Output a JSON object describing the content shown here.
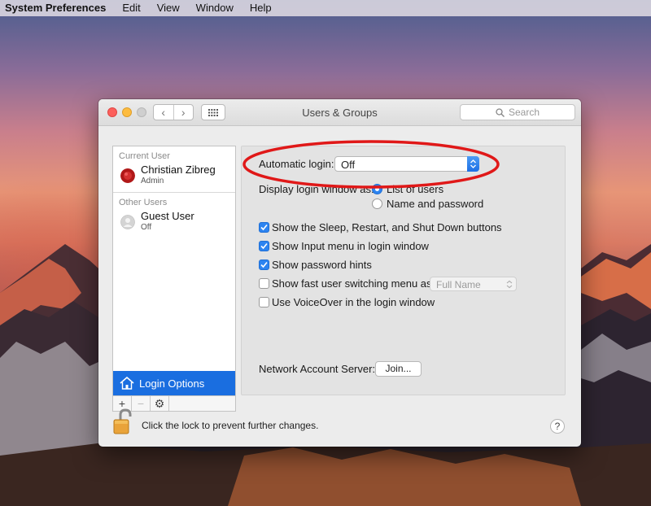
{
  "menubar": {
    "app": "System Preferences",
    "items": [
      "Edit",
      "View",
      "Window",
      "Help"
    ]
  },
  "window": {
    "title": "Users & Groups",
    "search_placeholder": "Search"
  },
  "sidebar": {
    "current_user_header": "Current User",
    "current_user": {
      "name": "Christian Zibreg",
      "role": "Admin"
    },
    "other_users_header": "Other Users",
    "other_users": [
      {
        "name": "Guest User",
        "role": "Off"
      }
    ],
    "login_options": "Login Options"
  },
  "panel": {
    "automatic_login_label": "Automatic login:",
    "automatic_login_value": "Off",
    "display_login_label": "Display login window as:",
    "display_options": [
      {
        "label": "List of users",
        "selected": true
      },
      {
        "label": "Name and password",
        "selected": false
      }
    ],
    "checkboxes": [
      {
        "label": "Show the Sleep, Restart, and Shut Down buttons",
        "checked": true
      },
      {
        "label": "Show Input menu in login window",
        "checked": true
      },
      {
        "label": "Show password hints",
        "checked": true
      },
      {
        "label": "Show fast user switching menu as",
        "checked": false
      },
      {
        "label": "Use VoiceOver in the login window",
        "checked": false
      }
    ],
    "fast_switch_value": "Full Name",
    "network_server_label": "Network Account Server:",
    "join_button": "Join..."
  },
  "footer": {
    "lock_text": "Click the lock to prevent further changes.",
    "help": "?"
  },
  "colors": {
    "accent": "#2d84f0",
    "selection": "#1a6ee0",
    "annotation": "#e01818"
  }
}
